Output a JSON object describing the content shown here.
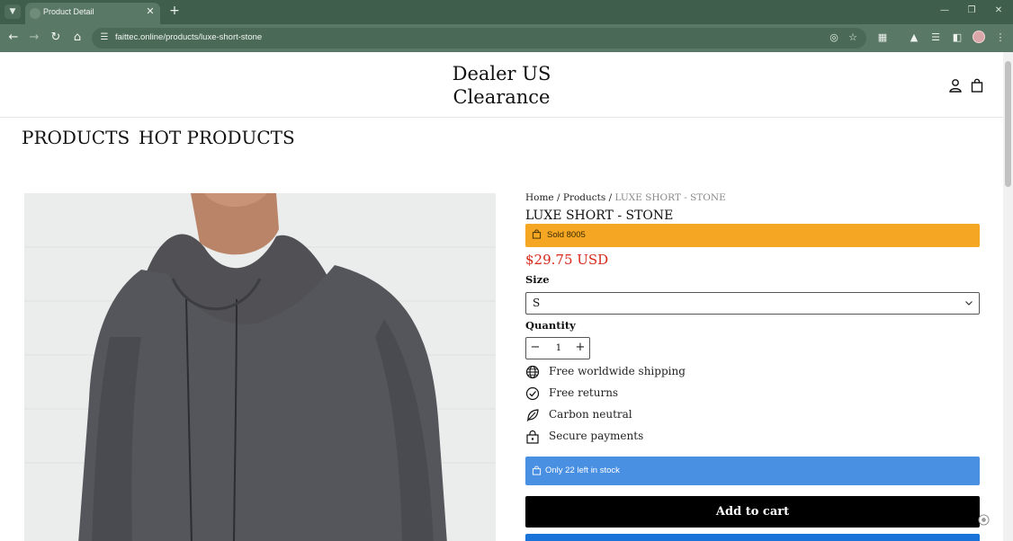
{
  "browser": {
    "tab_title": "Product Detail",
    "url": "faittec.online/products/luxe-short-stone"
  },
  "header": {
    "brand_line1": "Dealer US",
    "brand_line2": "Clearance",
    "account_icon": "person-icon",
    "cart_icon": "shopping-bag-icon"
  },
  "nav": {
    "items": [
      "PRODUCTS",
      "HOT PRODUCTS"
    ]
  },
  "breadcrumb": {
    "home": "Home",
    "sep1": " / ",
    "products": "Products",
    "sep2": " / ",
    "current": "LUXE SHORT - STONE"
  },
  "product": {
    "title": "LUXE SHORT - STONE",
    "sold_text": "Sold 8005",
    "price": "$29.75 USD",
    "size_label": "Size",
    "size_value": "S",
    "quantity_label": "Quantity",
    "quantity_value": "1",
    "features": [
      {
        "icon": "globe-icon",
        "text": "Free worldwide shipping"
      },
      {
        "icon": "check-circle-icon",
        "text": "Free returns"
      },
      {
        "icon": "leaf-icon",
        "text": "Carbon neutral"
      },
      {
        "icon": "lock-bag-icon",
        "text": "Secure payments"
      }
    ],
    "stock_text": "Only 22 left in stock",
    "add_to_cart_label": "Add to cart"
  },
  "colors": {
    "sold_banner": "#f5a623",
    "price": "#d7281a",
    "stock_banner": "#4a90e2",
    "cart_button": "#000000",
    "buy_now_button": "#1a73d9",
    "browser_chrome": "#5a7866"
  }
}
